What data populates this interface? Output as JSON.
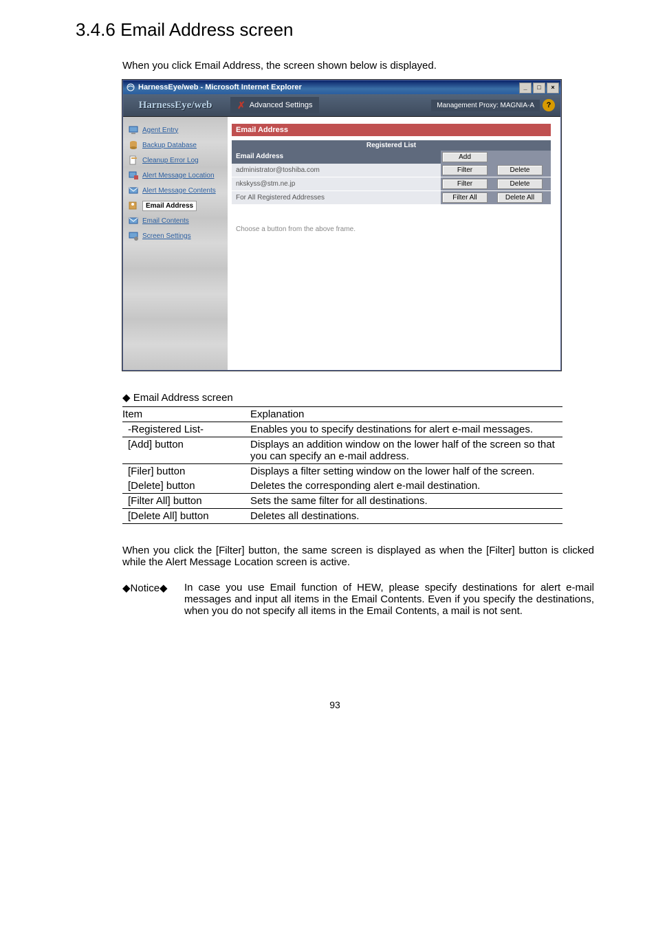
{
  "heading": {
    "number": "3.4.6",
    "title": "Email Address screen"
  },
  "intro": "When you click Email Address, the screen shown below is displayed.",
  "window": {
    "title": "HarnessEye/web - Microsoft Internet Explorer",
    "app_logo": "HarnessEye/web",
    "advanced_settings": "Advanced Settings",
    "management_proxy": "Management Proxy: MAGNIA-A",
    "help_glyph": "?",
    "controls": {
      "min": "_",
      "max": "□",
      "close": "×"
    }
  },
  "sidebar": {
    "items": [
      {
        "label": "Agent Entry"
      },
      {
        "label": "Backup Database"
      },
      {
        "label": "Cleanup Error Log"
      },
      {
        "label": "Alert Message Location"
      },
      {
        "label": "Alert Message Contents"
      },
      {
        "label": "Email Address",
        "selected": true
      },
      {
        "label": "Email Contents"
      },
      {
        "label": "Screen Settings"
      }
    ]
  },
  "panel": {
    "title": "Email Address",
    "registered_list": "Registered List",
    "column_header": "Email Address",
    "add_btn": "Add",
    "rows": [
      {
        "email": "administrator@toshiba.com",
        "filter": "Filter",
        "delete": "Delete"
      },
      {
        "email": "nkskyss@stm.ne.jp",
        "filter": "Filter",
        "delete": "Delete"
      }
    ],
    "footer_row": {
      "label": "For All Registered Addresses",
      "filter": "Filter All",
      "delete": "Delete All"
    },
    "lower_msg": "Choose a button from the above frame."
  },
  "spec_intro": "◆ Email Address screen",
  "spec_header": {
    "item": "Item",
    "explanation": "Explanation"
  },
  "spec_rows": [
    {
      "item": "-Registered List-",
      "explanation": "Enables you to specify destinations for alert e-mail messages."
    },
    {
      "item": "[Add] button",
      "explanation": "Displays an addition window on the lower half of the screen so that you can specify an e-mail address."
    },
    {
      "item": "[Filer] button",
      "explanation": "Displays a filter setting window on the lower half of the screen."
    },
    {
      "item": "[Delete] button",
      "explanation": "Deletes the corresponding alert e-mail destination."
    },
    {
      "item": "[Filter All] button",
      "explanation": "Sets the same filter for all destinations."
    },
    {
      "item": "[Delete All] button",
      "explanation": "Deletes all destinations."
    }
  ],
  "post_table_para": "When you click the [Filter] button, the same screen is displayed as when the [Filter] button is clicked while the Alert Message Location screen is active.",
  "notice": {
    "label": "◆Notice◆",
    "body": "In case you use Email function of HEW, please specify destinations for alert e-mail messages and input all items in the Email Contents. Even if you specify the destinations, when you do not specify all items in the Email Contents, a mail is not sent."
  },
  "page_number": "93"
}
